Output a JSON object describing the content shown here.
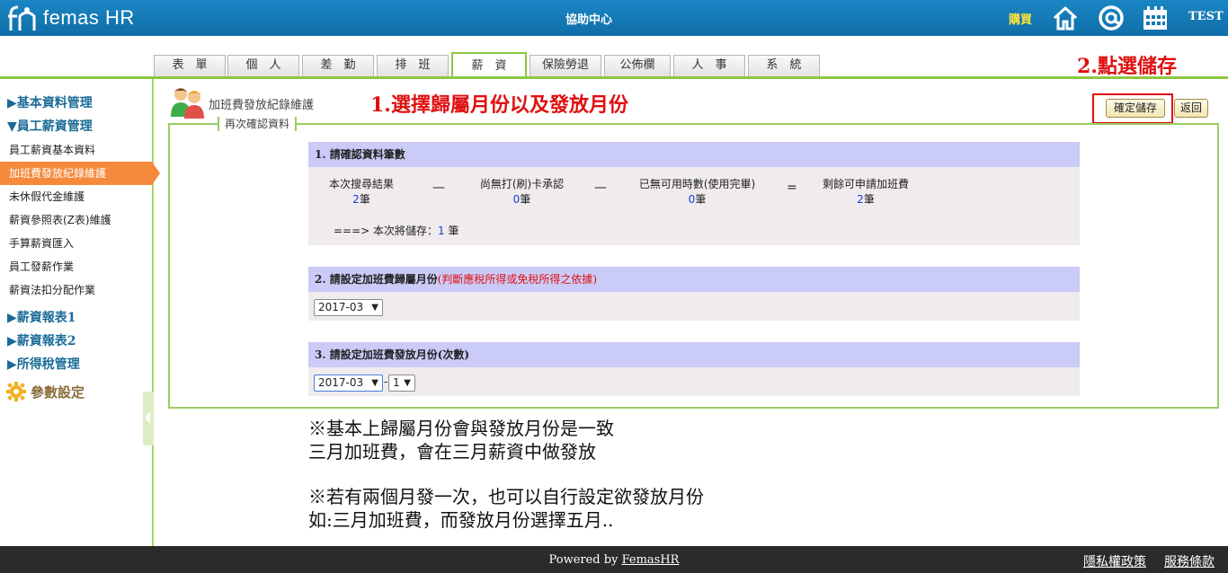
{
  "header": {
    "logo_text": "femas HR",
    "help_center": "協助中心",
    "buy": "購買",
    "user": "TEST",
    "icons": [
      "home-icon",
      "at-icon",
      "calendar-icon"
    ]
  },
  "tabs": [
    "表　單",
    "個　人",
    "差　勤",
    "排　班",
    "薪　資",
    "保險勞退",
    "公佈欄",
    "人　事",
    "系　統"
  ],
  "annotations": {
    "save_hint": "2.點選儲存",
    "step1_hint": "1.選擇歸屬月份以及發放月份"
  },
  "sidebar": {
    "group_basic": "▶基本資料管理",
    "group_salary": "▼員工薪資管理",
    "items": [
      "員工薪資基本資料",
      "加班費發放紀錄維護",
      "未休假代金維護",
      "薪資參照表(Z表)維護",
      "手算薪資匯入",
      "員工發薪作業",
      "薪資法扣分配作業"
    ],
    "group_report1": "▶薪資報表1",
    "group_report2": "▶薪資報表2",
    "group_tax": "▶所得稅管理",
    "param": "參數設定"
  },
  "page": {
    "title": "加班費發放紀錄維護",
    "confirm_button": "確定儲存",
    "back_button": "返回",
    "legend": "再次確認資料"
  },
  "section1": {
    "title": "1. 請確認資料筆數",
    "stats": [
      {
        "label": "本次搜尋結果",
        "value": "2",
        "unit": "筆"
      },
      {
        "label": "尚無打(刷)卡承認",
        "value": "0",
        "unit": "筆"
      },
      {
        "label": "已無可用時數(使用完畢)",
        "value": "0",
        "unit": "筆"
      },
      {
        "label": "剩餘可申請加班費",
        "value": "2",
        "unit": "筆"
      }
    ],
    "ops": [
      "—",
      "—",
      "="
    ],
    "summary_prefix": "===> 本次將儲存：",
    "summary_value": "1",
    "summary_unit": " 筆"
  },
  "section2": {
    "title": "2. 請設定加班費歸屬月份",
    "note": "(判斷應稅所得或免稅所得之依據)",
    "month": "2017-03"
  },
  "section3": {
    "title": "3. 請設定加班費發放月份(次數)",
    "month": "2017-03",
    "separator": "-",
    "times": "1"
  },
  "notes": {
    "line1": "※基本上歸屬月份會與發放月份是一致",
    "line2": "三月加班費，會在三月薪資中做發放",
    "line3": "※若有兩個月發一次，也可以自行設定欲發放月份",
    "line4": "如:三月加班費，而發放月份選擇五月.."
  },
  "footer": {
    "powered_prefix": "Powered by ",
    "powered_link": "FemasHR",
    "privacy": "隱私權政策",
    "terms": "服務條款"
  }
}
